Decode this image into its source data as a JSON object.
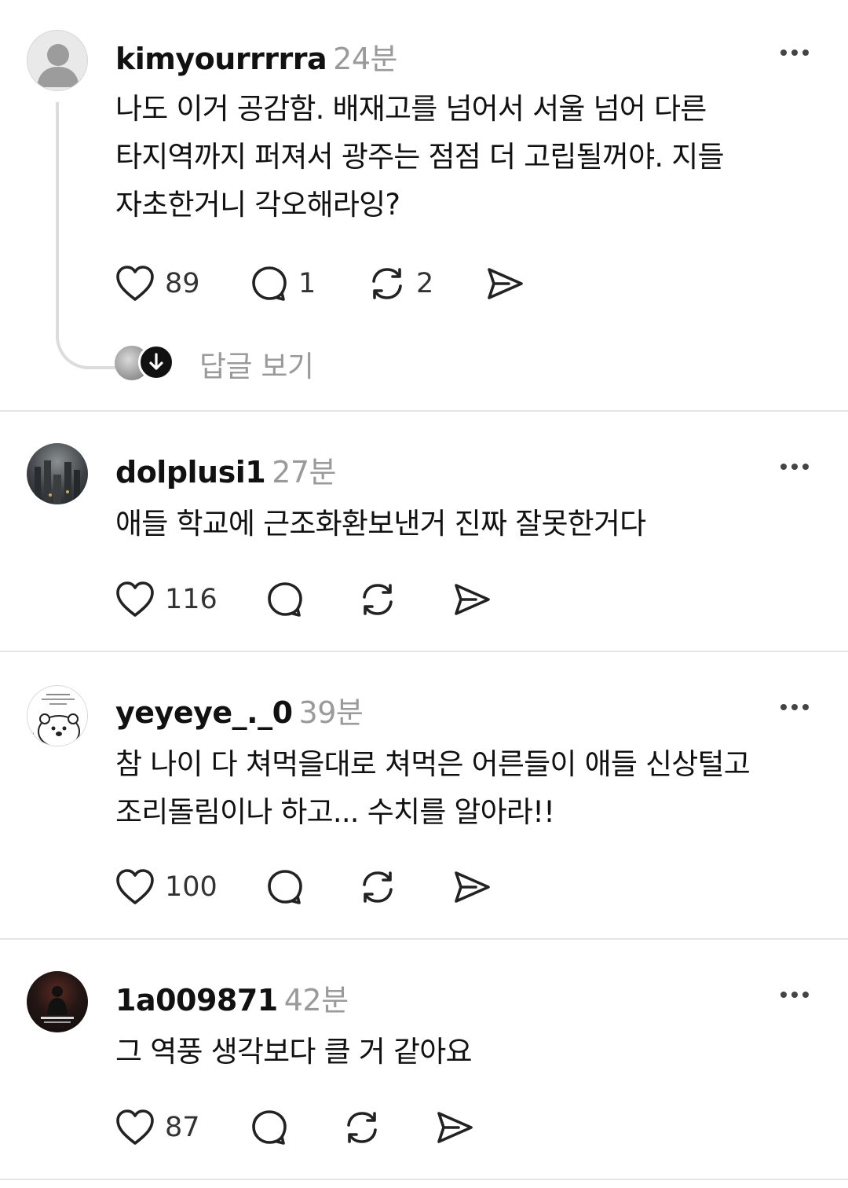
{
  "comments": [
    {
      "username": "kimyourrrrra",
      "time": "24분",
      "text_lines": [
        "나도 이거 공감함. 배재고를 넘어서 서울 넘어 다른",
        "타지역까지 퍼져서 광주는 점점 더 고립될꺼야. 지들",
        "자초한거니 각오해라잉?"
      ],
      "likes": "89",
      "replies": "1",
      "reposts": "2",
      "avatar_icon": "default-person-icon",
      "view_replies_label": "답글 보기"
    },
    {
      "username": "dolplusi1",
      "time": "27분",
      "text_lines": [
        "애들 학교에 근조화환보낸거 진짜 잘못한거다"
      ],
      "likes": "116",
      "replies": "",
      "reposts": "",
      "avatar_icon": "city-photo-avatar"
    },
    {
      "username": "yeyeye_._0",
      "time": "39분",
      "text_lines": [
        "참 나이 다 쳐먹을대로 쳐먹은 어른들이 애들 신상털고",
        "조리돌림이나 하고... 수치를 알아라!!"
      ],
      "likes": "100",
      "replies": "",
      "reposts": "",
      "avatar_icon": "cartoon-bear-avatar"
    },
    {
      "username": "1a009871",
      "time": "42분",
      "text_lines": [
        "그 역풍 생각보다 클 거 같아요"
      ],
      "likes": "87",
      "replies": "",
      "reposts": "",
      "avatar_icon": "poster-avatar"
    }
  ],
  "colors": {
    "text": "#111111",
    "muted": "#9a9a9a",
    "divider": "#e6e6e6",
    "icon": "#222222"
  }
}
